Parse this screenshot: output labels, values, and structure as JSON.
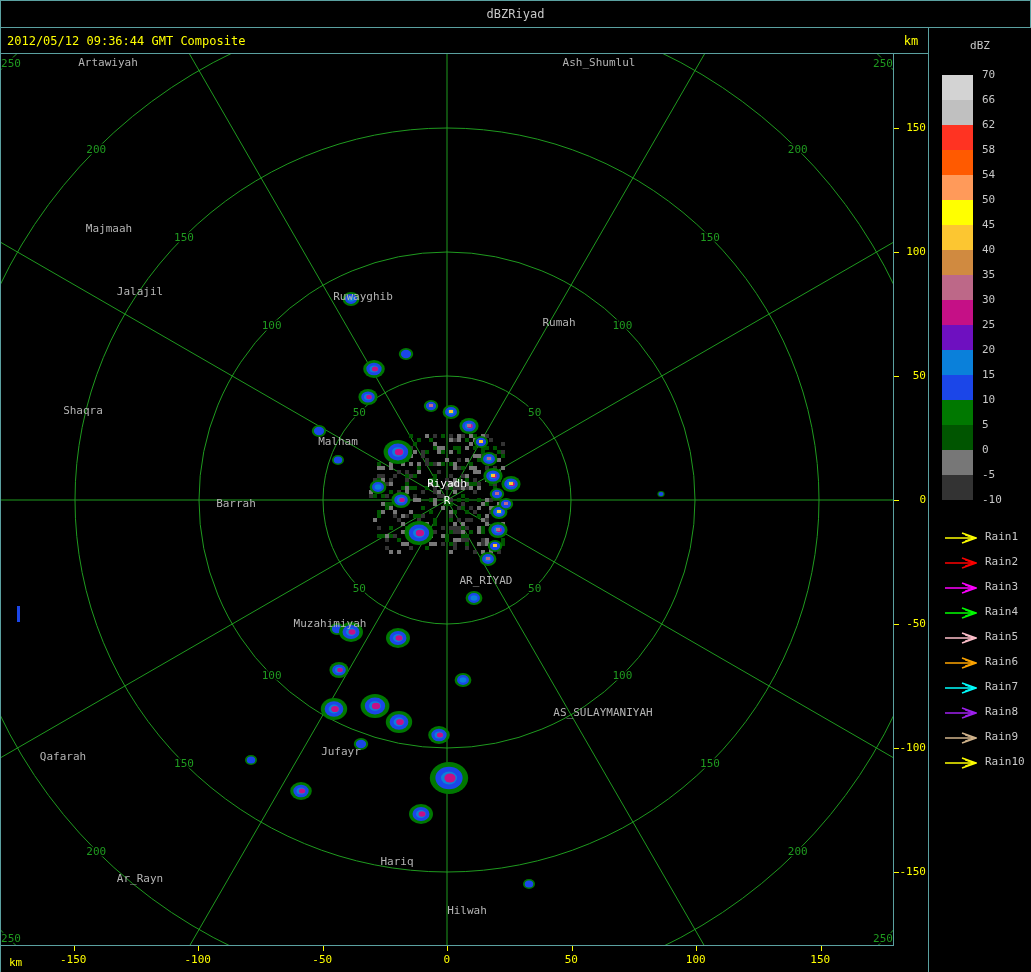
{
  "window": {
    "title": "dBZRiyad"
  },
  "header": {
    "timestamp": "2012/05/12 09:36:44 GMT Composite"
  },
  "rings": [
    {
      "labels": [
        "50",
        "50",
        "50",
        "50"
      ]
    },
    {
      "labels": [
        "100",
        "100",
        "100",
        "100"
      ]
    },
    {
      "labels": [
        "150",
        "150",
        "150",
        "150"
      ]
    },
    {
      "labels": [
        "200",
        "200",
        "200",
        "200"
      ]
    },
    {
      "labels": [
        "250",
        "250",
        "250",
        "250"
      ]
    }
  ],
  "places": [
    {
      "name": "Artawiyah",
      "highlighted": false
    },
    {
      "name": "Ash_Shumlul",
      "highlighted": false
    },
    {
      "name": "Majmaah",
      "highlighted": false
    },
    {
      "name": "Jalajil",
      "highlighted": false
    },
    {
      "name": "Ruwayghib",
      "highlighted": false
    },
    {
      "name": "Rumah",
      "highlighted": false
    },
    {
      "name": "Shaqra",
      "highlighted": false
    },
    {
      "name": "Malham",
      "highlighted": false
    },
    {
      "name": "Riyadh",
      "highlighted": true
    },
    {
      "name": "R",
      "highlighted": true
    },
    {
      "name": "Barrah",
      "highlighted": false
    },
    {
      "name": "AR_RIYAD",
      "highlighted": false
    },
    {
      "name": "Muzahimiyah",
      "highlighted": false
    },
    {
      "name": "AS_SULAYMANIYAH",
      "highlighted": false
    },
    {
      "name": "Jufayr",
      "highlighted": false
    },
    {
      "name": "Qafarah",
      "highlighted": false
    },
    {
      "name": "Hariq",
      "highlighted": false
    },
    {
      "name": "Ar_Rayn",
      "highlighted": false
    },
    {
      "name": "Hilwah",
      "highlighted": false
    }
  ],
  "right_axis": {
    "unit": "km",
    "ticks": [
      "150",
      "100",
      "50",
      "0",
      "-50",
      "-100",
      "-150"
    ]
  },
  "bottom_axis": {
    "unit": "km",
    "ticks": [
      "-150",
      "-100",
      "-50",
      "0",
      "50",
      "100",
      "150"
    ]
  },
  "color_scale": {
    "title": "dBZ",
    "bins": [
      {
        "color": "#d3d3d3"
      },
      {
        "color": "#c0c0c0"
      },
      {
        "color": "#ff3322"
      },
      {
        "color": "#ff5a00"
      },
      {
        "color": "#ff9a5a"
      },
      {
        "color": "#ffff00"
      },
      {
        "color": "#fcc631"
      },
      {
        "color": "#d08a40"
      },
      {
        "color": "#bd6888"
      },
      {
        "color": "#c51086"
      },
      {
        "color": "#6e10c0"
      },
      {
        "color": "#0a80da"
      },
      {
        "color": "#1b46e8"
      },
      {
        "color": "#007800"
      },
      {
        "color": "#005500"
      },
      {
        "color": "#777777"
      },
      {
        "color": "#333333"
      }
    ],
    "labels": [
      "70",
      "66",
      "62",
      "58",
      "54",
      "50",
      "45",
      "40",
      "35",
      "30",
      "25",
      "20",
      "15",
      "10",
      "5",
      "0",
      "-5",
      "-10"
    ]
  },
  "legend": [
    {
      "label": "Rain1",
      "color": "#ffff00"
    },
    {
      "label": "Rain2",
      "color": "#ff0000"
    },
    {
      "label": "Rain3",
      "color": "#ff00ff"
    },
    {
      "label": "Rain4",
      "color": "#00ff00"
    },
    {
      "label": "Rain5",
      "color": "#ffc0cb"
    },
    {
      "label": "Rain6",
      "color": "#ffa500"
    },
    {
      "label": "Rain7",
      "color": "#00ffff"
    },
    {
      "label": "Rain8",
      "color": "#a020f0"
    },
    {
      "label": "Rain9",
      "color": "#d2b48c"
    },
    {
      "label": "Rain10",
      "color": "#ffff00"
    }
  ]
}
